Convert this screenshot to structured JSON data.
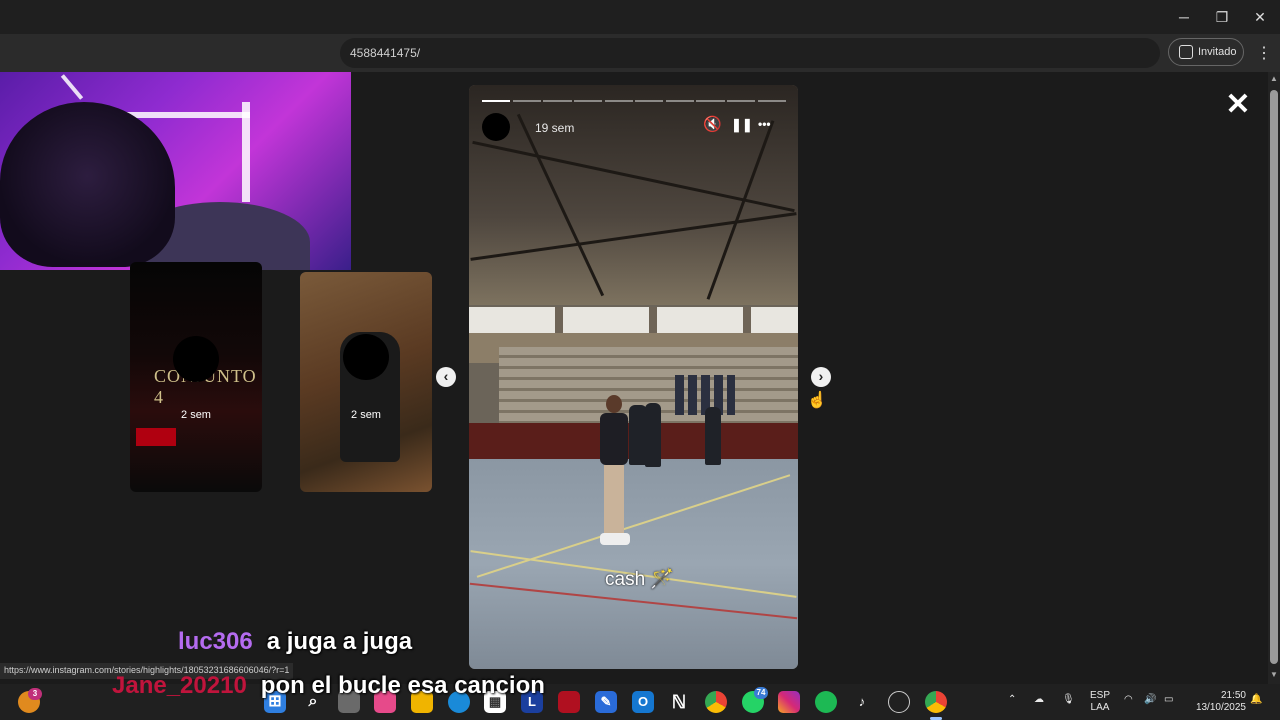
{
  "browser": {
    "url_fragment": "4588441475/",
    "guest_label": "Invitado",
    "minimize": "─",
    "maximize": "❐",
    "close": "✕",
    "menu": "⋮"
  },
  "viewer": {
    "close_glyph": "✕",
    "prev_glyph": "‹",
    "next_glyph": "›",
    "thumbnails": [
      {
        "time": "2 sem",
        "text": "CONJUNTO 4"
      },
      {
        "time": "2 sem"
      }
    ],
    "story": {
      "time": "19 sem",
      "caption": "cash",
      "caption_emoji": "🪄",
      "mute_glyph": "🔇",
      "pause_glyph": "❚❚",
      "more_glyph": "•••",
      "progress_segments": 10,
      "active_segment": 0
    }
  },
  "chat": [
    {
      "user": "luc306",
      "message": "a juga a juga",
      "color": "#b56cf0"
    },
    {
      "user": "Jane_20210",
      "message": "pon el bucle esa cancion",
      "color": "#c0143c"
    }
  ],
  "status_url": "https://www.instagram.com/stories/highlights/18053231686606046/?r=1",
  "taskbar": {
    "fire_badge": "3",
    "whatsapp_badge": "74",
    "lang_line1": "ESP",
    "lang_line2": "LAA",
    "time": "21:50",
    "date": "13/10/2025"
  }
}
